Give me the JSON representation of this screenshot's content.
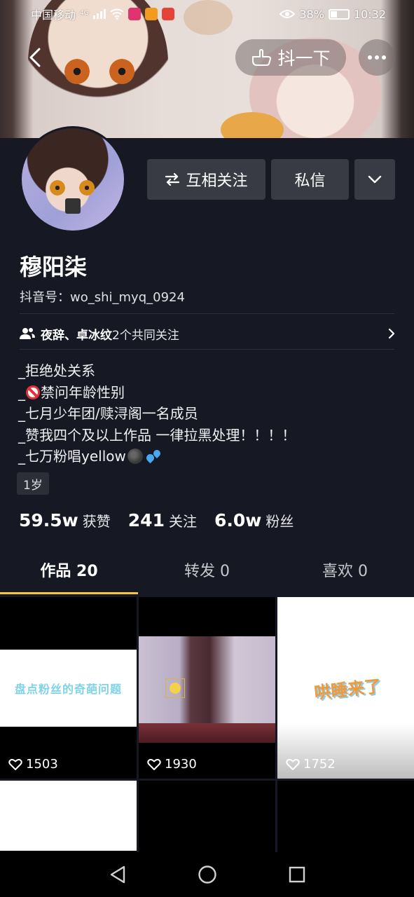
{
  "status_bar": {
    "carrier": "中国移动",
    "network": "4G",
    "battery": "38%",
    "time": "10:32"
  },
  "top_nav": {
    "shake_label": "抖一下"
  },
  "profile": {
    "nickname": "穆阳柒",
    "douyin_id": "抖音号：wo_shi_myq_0924",
    "follow_button": "互相关注",
    "message_button": "私信",
    "mutual": {
      "names": "夜辞、卓冰纹",
      "suffix": "2个共同关注"
    },
    "bio": [
      "_拒绝处关系",
      "禁问年龄性别",
      "_七月少年团/赎浔阁一名成员",
      "_赞我四个及以上作品  一律拉黑处理！！！！",
      "_七万粉唱yellow"
    ],
    "bio_prefix": "_",
    "age_tag": "1岁",
    "stats": {
      "likes_num": "59.5w",
      "likes_label": "获赞",
      "following_num": "241",
      "following_label": "关注",
      "fans_num": "6.0w",
      "fans_label": "粉丝"
    }
  },
  "tabs": [
    {
      "label": "作品 20",
      "active": true
    },
    {
      "label": "转发 0",
      "active": false
    },
    {
      "label": "喜欢 0",
      "active": false
    }
  ],
  "videos": [
    {
      "caption": "盘点粉丝的奇葩问题",
      "likes": "1503"
    },
    {
      "caption": "",
      "likes": "1930"
    },
    {
      "caption": "哄睡来了",
      "likes": "1752"
    }
  ],
  "colors": {
    "background": "#161823",
    "button": "#393b44",
    "tab_indicator": "#f7c53b"
  }
}
